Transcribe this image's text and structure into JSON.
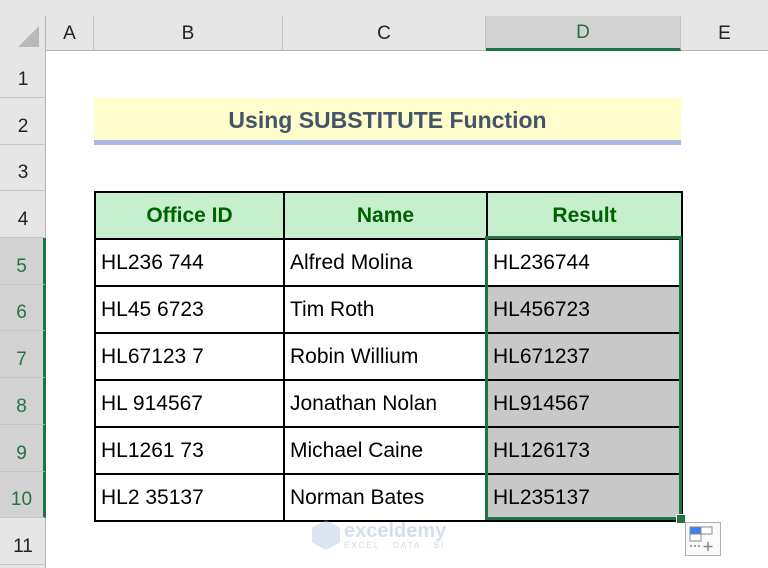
{
  "sheet": {
    "columns": [
      "A",
      "B",
      "C",
      "D",
      "E"
    ],
    "selected_column": "D",
    "rows": [
      "1",
      "2",
      "3",
      "4",
      "5",
      "6",
      "7",
      "8",
      "9",
      "10",
      "11"
    ],
    "selected_rows": [
      "5",
      "6",
      "7",
      "8",
      "9",
      "10"
    ]
  },
  "title": "Using SUBSTITUTE Function",
  "table": {
    "headers": [
      "Office ID",
      "Name",
      "Result"
    ],
    "rows": [
      {
        "office_id": "HL236 744",
        "name": "Alfred Molina",
        "result": "HL236744"
      },
      {
        "office_id": "HL45 6723",
        "name": "Tim Roth",
        "result": "HL456723"
      },
      {
        "office_id": "HL67123 7",
        "name": "Robin Willium",
        "result": "HL671237"
      },
      {
        "office_id": "HL 914567",
        "name": "Jonathan Nolan",
        "result": "HL914567"
      },
      {
        "office_id": "HL1261 73",
        "name": "Michael Caine",
        "result": "HL126173"
      },
      {
        "office_id": "HL2 35137",
        "name": "Norman Bates",
        "result": "HL235137"
      }
    ]
  },
  "watermark": {
    "name": "exceldemy",
    "tagline": "EXCEL · DATA · BI"
  },
  "colors": {
    "selection": "#217346",
    "header_fill": "#c6efce",
    "header_text": "#006100",
    "title_fill": "#fffdcc"
  }
}
